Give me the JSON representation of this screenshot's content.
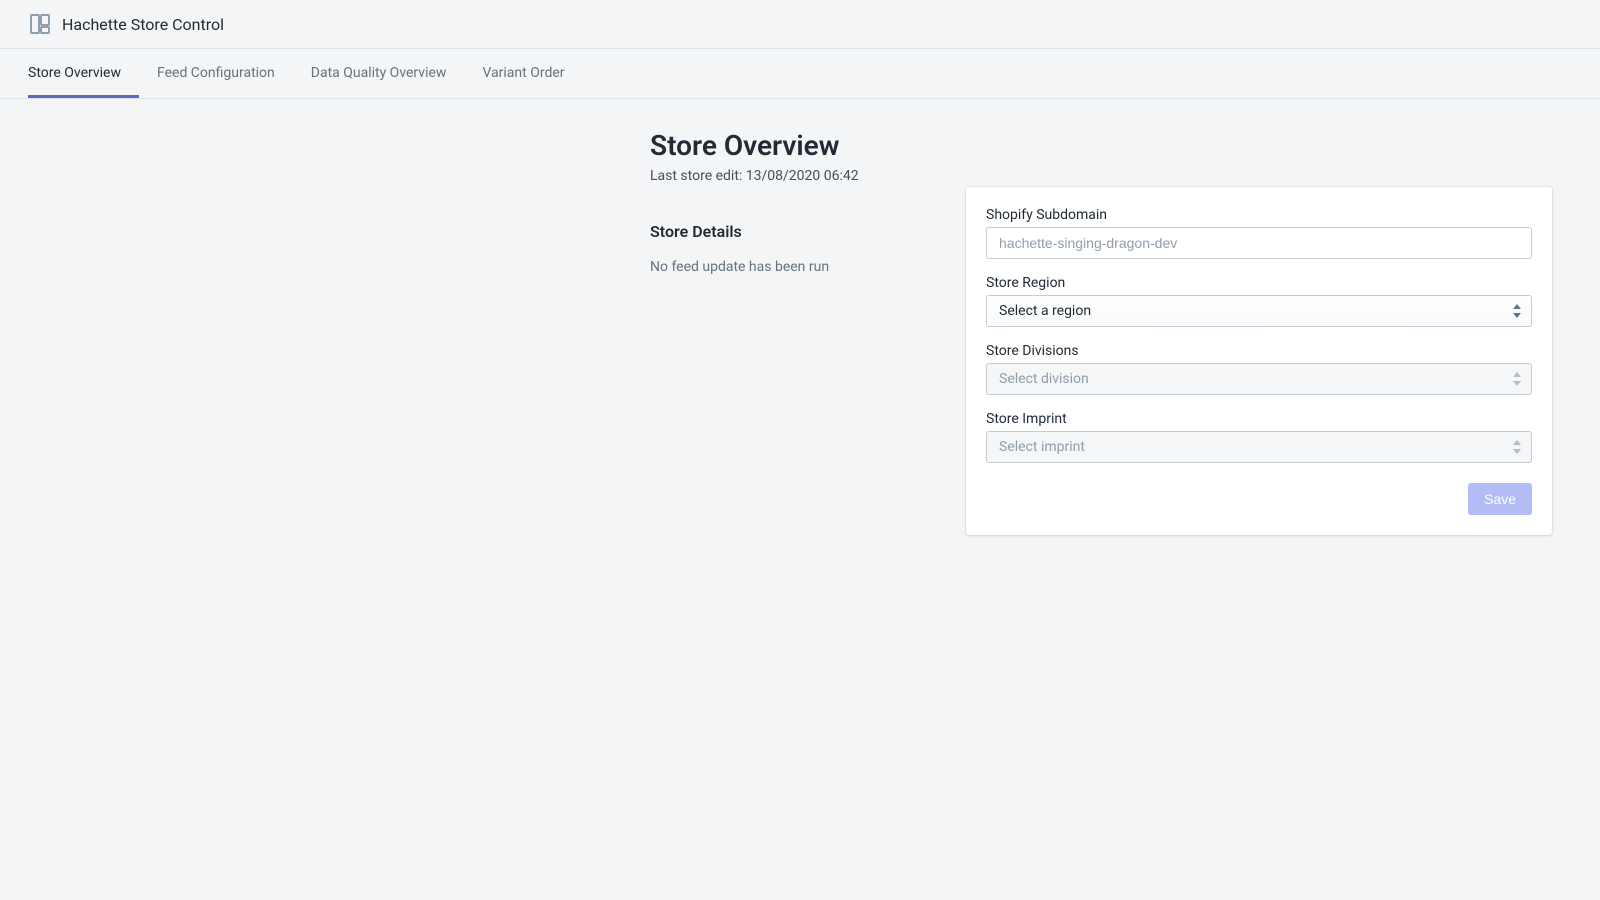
{
  "header": {
    "app_title": "Hachette Store Control"
  },
  "tabs": [
    {
      "label": "Store Overview",
      "active": true
    },
    {
      "label": "Feed Configuration",
      "active": false
    },
    {
      "label": "Data Quality Overview",
      "active": false
    },
    {
      "label": "Variant Order",
      "active": false
    }
  ],
  "page": {
    "title": "Store Overview",
    "subtitle": "Last store edit: 13/08/2020 06:42"
  },
  "details": {
    "heading": "Store Details",
    "text": "No feed update has been run"
  },
  "form": {
    "subdomain": {
      "label": "Shopify Subdomain",
      "placeholder": "hachette-singing-dragon-dev",
      "value": ""
    },
    "region": {
      "label": "Store Region",
      "selected": "Select a region"
    },
    "divisions": {
      "label": "Store Divisions",
      "selected": "Select division"
    },
    "imprint": {
      "label": "Store Imprint",
      "selected": "Select imprint"
    },
    "save_label": "Save"
  }
}
